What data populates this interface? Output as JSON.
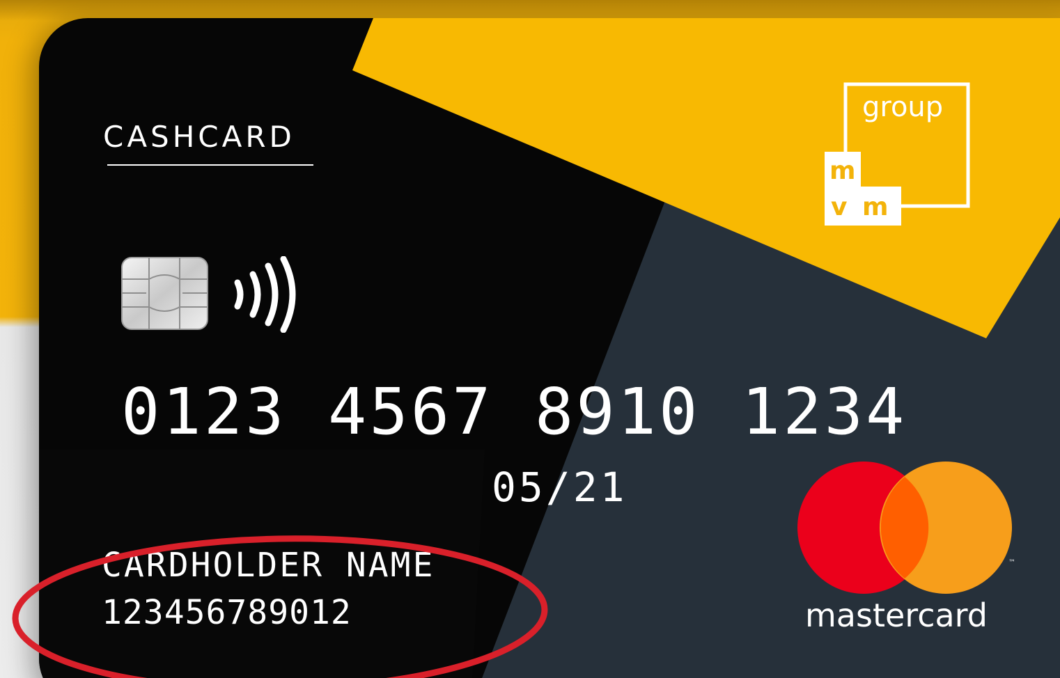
{
  "card": {
    "brand_label": "CASHCARD",
    "number": "0123 4567 8910 1234",
    "expiry": "05/21",
    "cardholder_name": "CARDHOLDER NAME",
    "cardholder_id": "123456789012"
  },
  "issuer_logo": {
    "word": "group",
    "letters": [
      "m",
      "v",
      "m"
    ]
  },
  "network_logo": {
    "name": "mastercard",
    "trademark": "™",
    "colors": {
      "red": "#eb001b",
      "orange": "#f79e1b",
      "overlap": "#ff5f00"
    }
  },
  "colors": {
    "card_black": "#060606",
    "card_slate": "#26303a",
    "accent_yellow": "#f8b902",
    "annotation_red": "#d9202a"
  },
  "icons": [
    "emv-chip-icon",
    "contactless-icon"
  ]
}
